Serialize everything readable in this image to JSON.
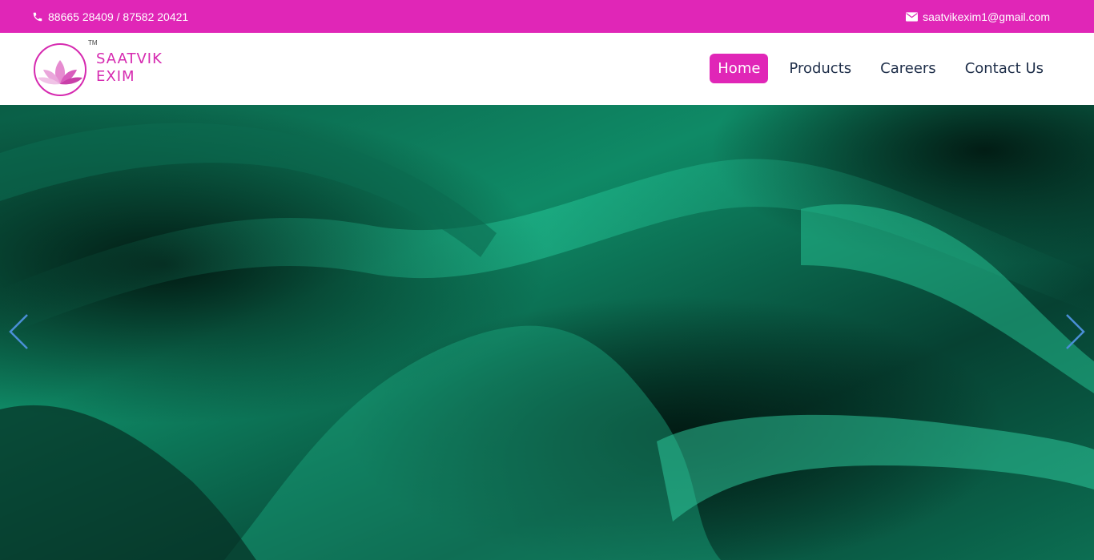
{
  "topbar": {
    "phone": "88665 28409 / 87582 20421",
    "email": "saatvikexim1@gmail.com",
    "phone_icon": "phone-icon",
    "email_icon": "envelope-icon",
    "bg_color": "#e026b7"
  },
  "brand": {
    "line1": "SAATVIK",
    "line2": "EXIM",
    "tm": "TM",
    "color": "#d62ab0"
  },
  "nav": {
    "items": [
      {
        "label": "Home",
        "active": true
      },
      {
        "label": "Products",
        "active": false
      },
      {
        "label": "Careers",
        "active": false
      },
      {
        "label": "Contact Us",
        "active": false
      }
    ]
  },
  "hero": {
    "prev_icon": "chevron-left-icon",
    "next_icon": "chevron-right-icon",
    "fabric_color": "#0f8a66"
  }
}
